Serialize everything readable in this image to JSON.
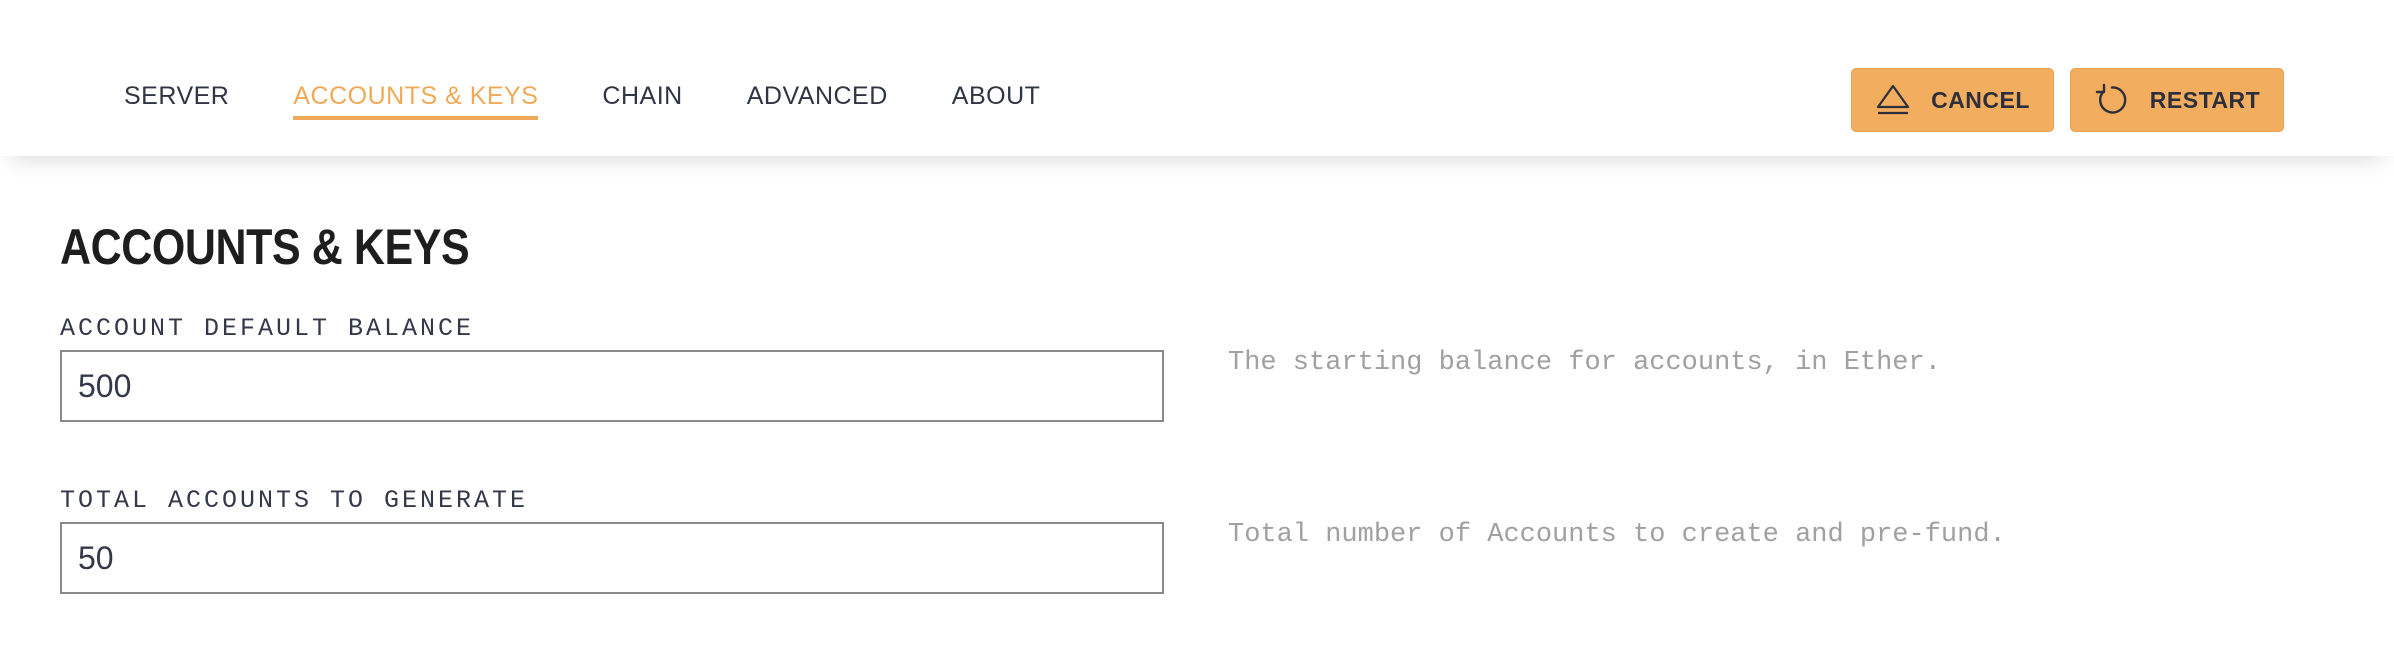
{
  "nav": {
    "items": [
      {
        "label": "SERVER",
        "active": false
      },
      {
        "label": "ACCOUNTS & KEYS",
        "active": true
      },
      {
        "label": "CHAIN",
        "active": false
      },
      {
        "label": "ADVANCED",
        "active": false
      },
      {
        "label": "ABOUT",
        "active": false
      }
    ]
  },
  "toolbar": {
    "cancel_label": "CANCEL",
    "cancel_icon": "eject-icon",
    "restart_label": "RESTART",
    "restart_icon": "restart-icon"
  },
  "colors": {
    "accent": "#f0a956",
    "button_bg": "#f2ad5f",
    "text_dark": "#2f3542",
    "help_text": "#a0a0a0",
    "input_border": "#8a8a8a"
  },
  "page": {
    "title": "ACCOUNTS & KEYS"
  },
  "fields": {
    "balance": {
      "label": "ACCOUNT DEFAULT BALANCE",
      "value": "500",
      "help": "The starting balance for accounts, in Ether."
    },
    "total_accounts": {
      "label": "TOTAL ACCOUNTS TO GENERATE",
      "value": "50",
      "help": "Total number of Accounts to create and pre-fund."
    }
  }
}
